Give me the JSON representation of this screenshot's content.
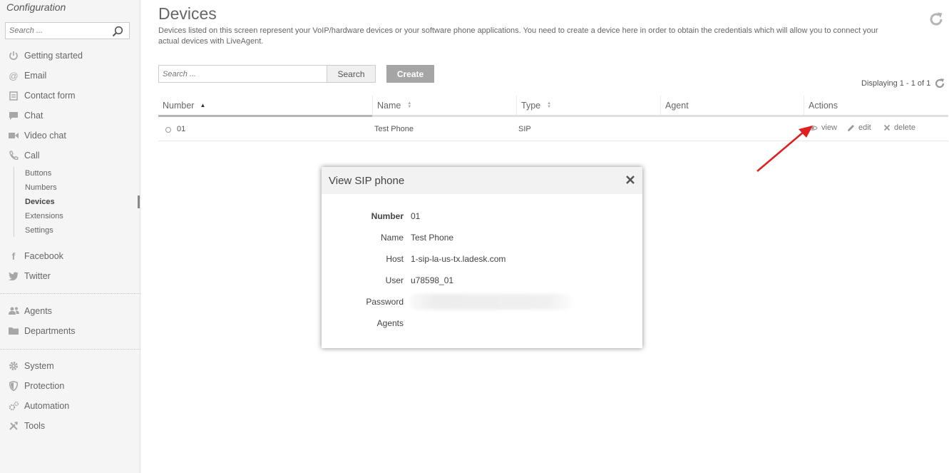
{
  "sidebar": {
    "title": "Configuration",
    "search_placeholder": "Search ...",
    "items": [
      {
        "label": "Getting started",
        "icon": "power-icon"
      },
      {
        "label": "Email",
        "icon": "at-icon"
      },
      {
        "label": "Contact form",
        "icon": "form-icon"
      },
      {
        "label": "Chat",
        "icon": "chat-icon"
      },
      {
        "label": "Video chat",
        "icon": "video-icon"
      },
      {
        "label": "Call",
        "icon": "phone-icon"
      }
    ],
    "call_subitems": [
      "Buttons",
      "Numbers",
      "Devices",
      "Extensions",
      "Settings"
    ],
    "active_subitem": "Devices",
    "social": [
      {
        "label": "Facebook",
        "icon": "facebook-icon"
      },
      {
        "label": "Twitter",
        "icon": "twitter-icon"
      }
    ],
    "org": [
      {
        "label": "Agents",
        "icon": "agents-icon"
      },
      {
        "label": "Departments",
        "icon": "folder-icon"
      }
    ],
    "system": [
      {
        "label": "System",
        "icon": "gear-icon"
      },
      {
        "label": "Protection",
        "icon": "shield-icon"
      },
      {
        "label": "Automation",
        "icon": "automation-icon"
      },
      {
        "label": "Tools",
        "icon": "tools-icon"
      }
    ]
  },
  "main": {
    "title": "Devices",
    "description": "Devices listed on this screen represent your VoIP/hardware devices or your software phone applications. You need to create a device here in order to obtain the credentials which will allow you to connect your actual devices with LiveAgent.",
    "search_placeholder": "Search ...",
    "search_button": "Search",
    "create_button": "Create",
    "displaying": "Displaying 1 - 1 of 1",
    "columns": [
      "Number",
      "Name",
      "Type",
      "Agent",
      "Actions"
    ],
    "rows": [
      {
        "number": "01",
        "name": "Test Phone",
        "type": "SIP",
        "agent": ""
      }
    ],
    "actions": {
      "view": "view",
      "edit": "edit",
      "delete": "delete"
    }
  },
  "modal": {
    "title": "View SIP phone",
    "fields": [
      {
        "label": "Number",
        "value": "01"
      },
      {
        "label": "Name",
        "value": "Test Phone"
      },
      {
        "label": "Host",
        "value": "1-sip-la-us-tx.ladesk.com"
      },
      {
        "label": "User",
        "value": "u78598_01"
      },
      {
        "label": "Password",
        "value": ""
      },
      {
        "label": "Agents",
        "value": ""
      }
    ]
  },
  "colors": {
    "sidebar_bg": "#f5f5f5",
    "create_button": "#a5a5a5",
    "annotation_arrow": "#e02020"
  }
}
